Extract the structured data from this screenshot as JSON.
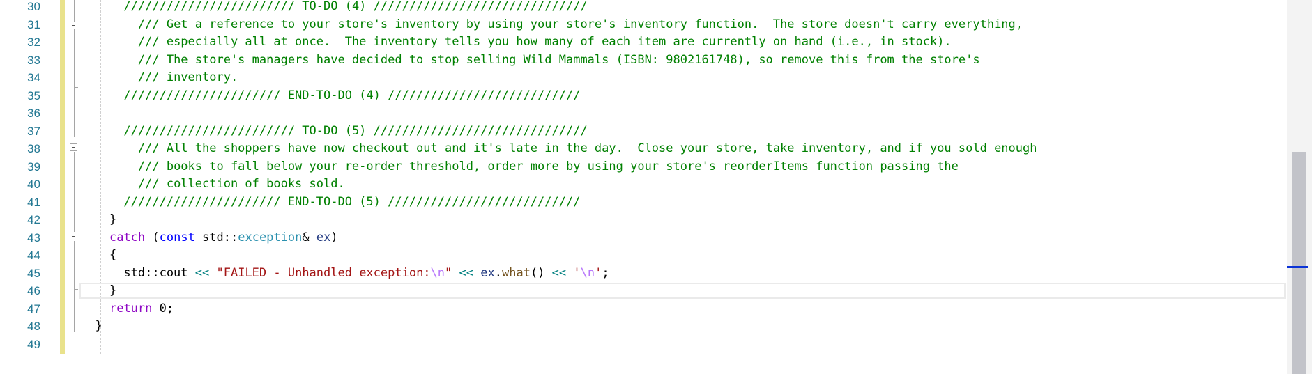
{
  "editor": {
    "line_numbers": [
      "30",
      "31",
      "32",
      "33",
      "34",
      "35",
      "36",
      "37",
      "38",
      "39",
      "40",
      "41",
      "42",
      "43",
      "44",
      "45",
      "46",
      "47",
      "48",
      "49"
    ],
    "lines": [
      {
        "segments": [
          {
            "t": "      ",
            "c": "nm"
          },
          {
            "t": "//////////////////////// TO-DO (4) //////////////////////////////",
            "c": "cm"
          }
        ]
      },
      {
        "segments": [
          {
            "t": "        ",
            "c": "nm"
          },
          {
            "t": "/// Get a reference to your store's inventory by using your store's inventory function.  The store doesn't carry everything,",
            "c": "cm"
          }
        ]
      },
      {
        "segments": [
          {
            "t": "        ",
            "c": "nm"
          },
          {
            "t": "/// especially all at once.  The inventory tells you how many of each item are currently on hand (i.e., in stock).",
            "c": "cm"
          }
        ]
      },
      {
        "segments": [
          {
            "t": "        ",
            "c": "nm"
          },
          {
            "t": "/// The store's managers have decided to stop selling Wild Mammals (ISBN: 9802161748), so remove this from the store's",
            "c": "cm"
          }
        ]
      },
      {
        "segments": [
          {
            "t": "        ",
            "c": "nm"
          },
          {
            "t": "/// inventory.",
            "c": "cm"
          }
        ]
      },
      {
        "segments": [
          {
            "t": "      ",
            "c": "nm"
          },
          {
            "t": "////////////////////// END-TO-DO (4) ///////////////////////////",
            "c": "cm"
          }
        ]
      },
      {
        "segments": [
          {
            "t": "",
            "c": "nm"
          }
        ]
      },
      {
        "segments": [
          {
            "t": "      ",
            "c": "nm"
          },
          {
            "t": "//////////////////////// TO-DO (5) //////////////////////////////",
            "c": "cm"
          }
        ]
      },
      {
        "segments": [
          {
            "t": "        ",
            "c": "nm"
          },
          {
            "t": "/// All the shoppers have now checkout out and it's late in the day.  Close your store, take inventory, and if you sold enough",
            "c": "cm"
          }
        ]
      },
      {
        "segments": [
          {
            "t": "        ",
            "c": "nm"
          },
          {
            "t": "/// books to fall below your re-order threshold, order more by using your store's reorderItems function passing the",
            "c": "cm"
          }
        ]
      },
      {
        "segments": [
          {
            "t": "        ",
            "c": "nm"
          },
          {
            "t": "/// collection of books sold.",
            "c": "cm"
          }
        ]
      },
      {
        "segments": [
          {
            "t": "      ",
            "c": "nm"
          },
          {
            "t": "////////////////////// END-TO-DO (5) ///////////////////////////",
            "c": "cm"
          }
        ]
      },
      {
        "segments": [
          {
            "t": "    }",
            "c": "nm"
          }
        ]
      },
      {
        "segments": [
          {
            "t": "    ",
            "c": "nm"
          },
          {
            "t": "catch",
            "c": "kw2"
          },
          {
            "t": " (",
            "c": "nm"
          },
          {
            "t": "const",
            "c": "kw"
          },
          {
            "t": " std::",
            "c": "nm"
          },
          {
            "t": "exception",
            "c": "ty"
          },
          {
            "t": "& ",
            "c": "nm"
          },
          {
            "t": "ex",
            "c": "pr"
          },
          {
            "t": ")",
            "c": "nm"
          }
        ]
      },
      {
        "segments": [
          {
            "t": "    {",
            "c": "nm"
          }
        ]
      },
      {
        "segments": [
          {
            "t": "      std::cout ",
            "c": "nm"
          },
          {
            "t": "<<",
            "c": "op"
          },
          {
            "t": " ",
            "c": "nm"
          },
          {
            "t": "\"FAILED - Unhandled exception:",
            "c": "st"
          },
          {
            "t": "\\n",
            "c": "es"
          },
          {
            "t": "\"",
            "c": "st"
          },
          {
            "t": " ",
            "c": "nm"
          },
          {
            "t": "<<",
            "c": "op"
          },
          {
            "t": " ",
            "c": "nm"
          },
          {
            "t": "ex",
            "c": "pr"
          },
          {
            "t": ".",
            "c": "nm"
          },
          {
            "t": "what",
            "c": "fn"
          },
          {
            "t": "() ",
            "c": "nm"
          },
          {
            "t": "<<",
            "c": "op"
          },
          {
            "t": " ",
            "c": "nm"
          },
          {
            "t": "'",
            "c": "st"
          },
          {
            "t": "\\n",
            "c": "es"
          },
          {
            "t": "'",
            "c": "st"
          },
          {
            "t": ";",
            "c": "nm"
          }
        ]
      },
      {
        "segments": [
          {
            "t": "    }",
            "c": "nm"
          }
        ]
      },
      {
        "segments": [
          {
            "t": "    ",
            "c": "nm"
          },
          {
            "t": "return",
            "c": "kw2"
          },
          {
            "t": " 0;",
            "c": "nm"
          }
        ]
      },
      {
        "segments": [
          {
            "t": "  }",
            "c": "nm"
          }
        ]
      },
      {
        "segments": [
          {
            "t": "",
            "c": "nm"
          }
        ]
      }
    ]
  },
  "colors": {
    "comment": "#008000",
    "keyword": "#0000ff",
    "control_keyword": "#8f08c4",
    "type": "#2b91af",
    "string": "#a31515",
    "escape": "#b776fb",
    "function": "#74531f",
    "line_number": "#237893",
    "change_bar": "#e9e28c",
    "scroll_marker": "#0b33d6"
  },
  "icons": {
    "fold_toggle": "collapse-minus-icon"
  }
}
